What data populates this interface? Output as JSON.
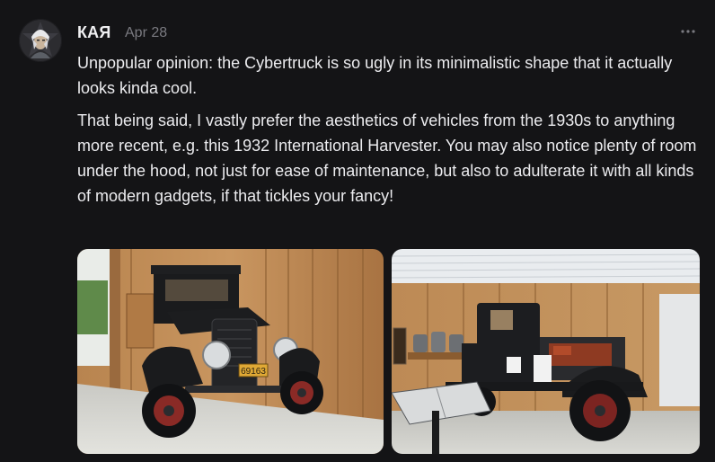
{
  "post": {
    "author": "КАЯ",
    "timestamp": "Apr 28",
    "paragraphs": [
      "Unpopular opinion: the Cybertruck is so ugly in its minimalistic shape that it actually looks kinda cool.",
      "That being said, I vastly prefer the aesthetics of vehicles from the 1930s to anything more recent, e.g. this 1932 International Harvester. You may also notice plenty of room under the hood, not just for ease of maintenance, but also to adulterate it with all kinds of modern gadgets, if that tickles your fancy!"
    ],
    "license_plate": "69163"
  },
  "icons": {
    "more": "more-horizontal-icon",
    "avatar": "avatar"
  },
  "colors": {
    "background": "#141416",
    "text": "#ececef",
    "muted": "#7a7a80"
  }
}
